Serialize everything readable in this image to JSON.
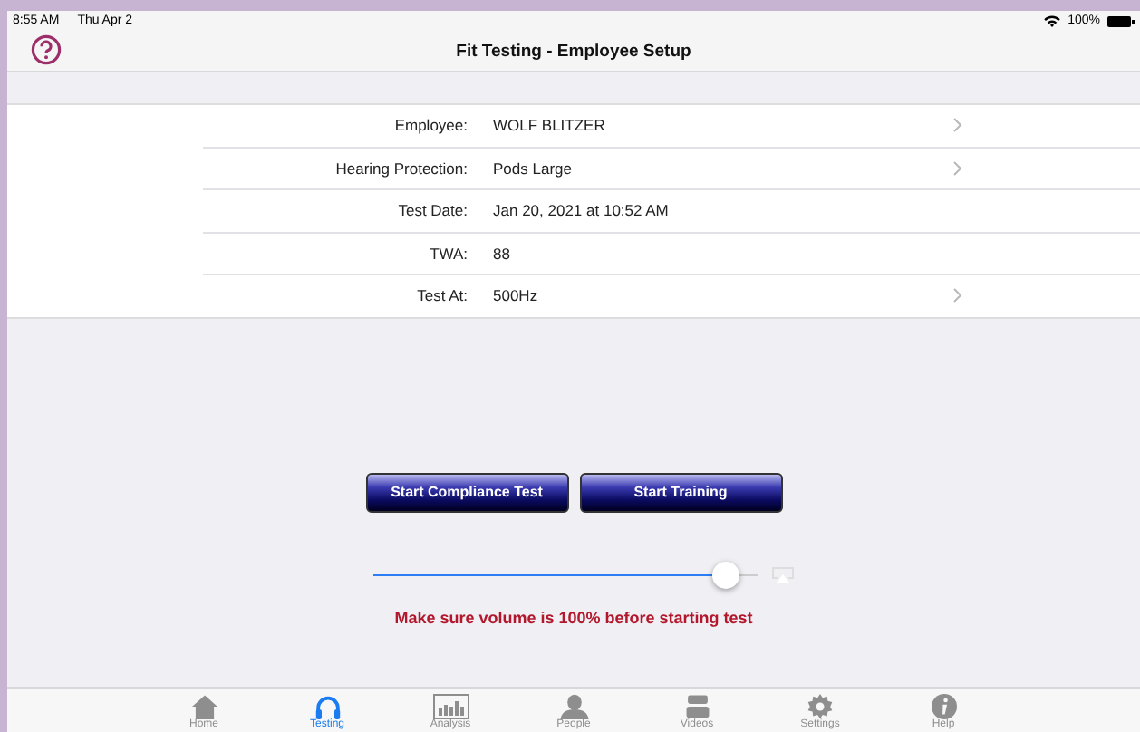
{
  "status_bar": {
    "time": "8:55 AM",
    "date": "Thu Apr 2",
    "battery": "100%"
  },
  "nav": {
    "title": "Fit Testing - Employee Setup"
  },
  "fields": [
    {
      "label": "Employee:",
      "value": "WOLF BLITZER",
      "disclosure": true
    },
    {
      "label": "Hearing Protection:",
      "value": "Pods Large",
      "disclosure": true
    },
    {
      "label": "Test Date:",
      "value": "Jan 20, 2021 at 10:52 AM",
      "disclosure": false
    },
    {
      "label": "TWA:",
      "value": "88",
      "disclosure": false
    },
    {
      "label": "Test At:",
      "value": "500Hz",
      "disclosure": true
    }
  ],
  "buttons": [
    "Start Compliance Test",
    "Start Training"
  ],
  "volume": {
    "level": 0.92
  },
  "warning": "Make sure volume is 100% before starting test",
  "tabs": [
    {
      "kind": "home",
      "label": "Home",
      "selected": false
    },
    {
      "kind": "testing",
      "label": "Testing",
      "selected": true
    },
    {
      "kind": "analysis",
      "label": "Analysis",
      "selected": false
    },
    {
      "kind": "people",
      "label": "People",
      "selected": false
    },
    {
      "kind": "videos",
      "label": "Videos",
      "selected": false
    },
    {
      "kind": "settings",
      "label": "Settings",
      "selected": false
    },
    {
      "kind": "help",
      "label": "Help",
      "selected": false
    }
  ]
}
